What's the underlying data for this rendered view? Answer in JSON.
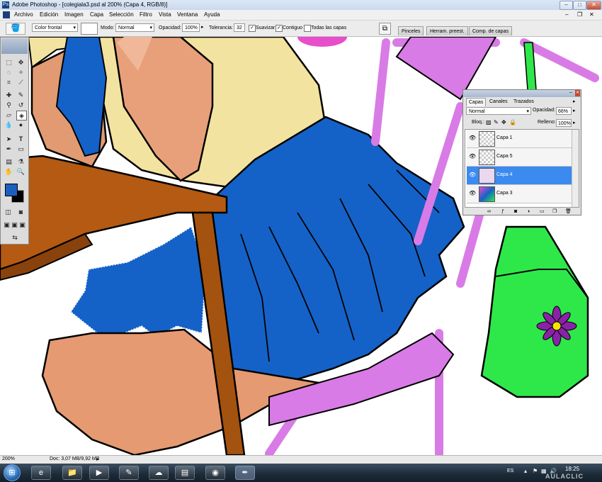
{
  "window": {
    "title": "Adobe Photoshop - [colegiala3.psd al 200% (Capa 4, RGB/8)]",
    "app_icon": "photoshop-logo",
    "buttons": [
      "minimize-icon",
      "maximize-icon",
      "close-icon"
    ]
  },
  "menu": {
    "items": [
      "Archivo",
      "Edición",
      "Imagen",
      "Capa",
      "Selección",
      "Filtro",
      "Vista",
      "Ventana",
      "Ayuda"
    ]
  },
  "options": {
    "tool_icon": "paint-bucket-icon",
    "fill_value": "Color frontal",
    "mode_label": "Modo:",
    "mode_value": "Normal",
    "opacity_label": "Opacidad:",
    "opacity_value": "100%",
    "tolerance_label": "Tolerancia:",
    "tolerance_value": "32",
    "antialias_label": "Suavizar",
    "contiguous_label": "Contiguo",
    "all_layers_label": "Todas las capas",
    "antialias_checked": true,
    "contiguous_checked": true,
    "all_layers_checked": false,
    "well_tabs": [
      "Pinceles",
      "Herram. preest.",
      "Comp. de capas"
    ]
  },
  "toolbox": {
    "foreground_color": "#1a5fbf",
    "background_color": "#000000"
  },
  "layers_panel": {
    "tabs": [
      "Capas",
      "Canales",
      "Trazados"
    ],
    "blend_mode": "Normal",
    "opacity_label": "Opacidad:",
    "opacity_value": "66%",
    "lock_label": "Bloq.:",
    "fill_label": "Relleno:",
    "fill_value": "100%",
    "layers": [
      {
        "name": "Capa 1",
        "selected": false
      },
      {
        "name": "Capa 5",
        "selected": false
      },
      {
        "name": "Capa 4",
        "selected": true
      },
      {
        "name": "Capa 3",
        "selected": false
      }
    ]
  },
  "status": {
    "zoom": "200%",
    "doc": "Doc: 3,07 MB/9,92 MB"
  },
  "taskbar": {
    "language": "ES",
    "time": "18:25",
    "watermark": "AULACLIC"
  },
  "colors": {
    "skirt_blue": "#1462c8",
    "chair_violet": "#d97be6",
    "bag_green": "#2ee84a",
    "shirt_yellow": "#f2e3a0",
    "skin": "#e9a27a",
    "table_brown": "#b45a12",
    "selection_blue": "#3b8af0"
  }
}
